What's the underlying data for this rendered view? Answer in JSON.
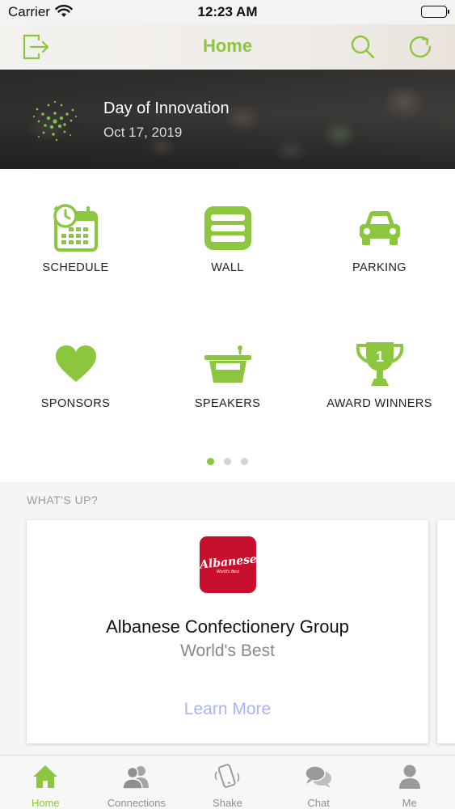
{
  "status_bar": {
    "carrier": "Carrier",
    "time": "12:23 AM"
  },
  "nav": {
    "title": "Home",
    "accent": "#8cc63f",
    "left_icon": "logout-icon",
    "right_icons": [
      "search-icon",
      "refresh-icon"
    ]
  },
  "event": {
    "title": "Day of Innovation",
    "date": "Oct 17, 2019"
  },
  "tiles": [
    {
      "label": "SCHEDULE",
      "icon": "calendar-clock-icon"
    },
    {
      "label": "WALL",
      "icon": "wall-icon"
    },
    {
      "label": "PARKING",
      "icon": "car-icon"
    },
    {
      "label": "SPONSORS",
      "icon": "heart-icon"
    },
    {
      "label": "SPEAKERS",
      "icon": "podium-icon"
    },
    {
      "label": "AWARD WINNERS",
      "icon": "trophy-icon"
    }
  ],
  "pager": {
    "pages": 3,
    "current": 1
  },
  "whats_up": {
    "heading": "WHAT'S UP?",
    "card": {
      "logo_text": "Albanese",
      "logo_subtext": "World's Best",
      "logo_color": "#c8102e",
      "title": "Albanese Confectionery Group",
      "subtitle": "World's Best",
      "link": "Learn More"
    }
  },
  "tabs": [
    {
      "label": "Home",
      "icon": "home-icon",
      "active": true
    },
    {
      "label": "Connections",
      "icon": "connections-icon",
      "active": false
    },
    {
      "label": "Shake",
      "icon": "shake-phone-icon",
      "active": false
    },
    {
      "label": "Chat",
      "icon": "chat-icon",
      "active": false
    },
    {
      "label": "Me",
      "icon": "person-icon",
      "active": false
    }
  ]
}
